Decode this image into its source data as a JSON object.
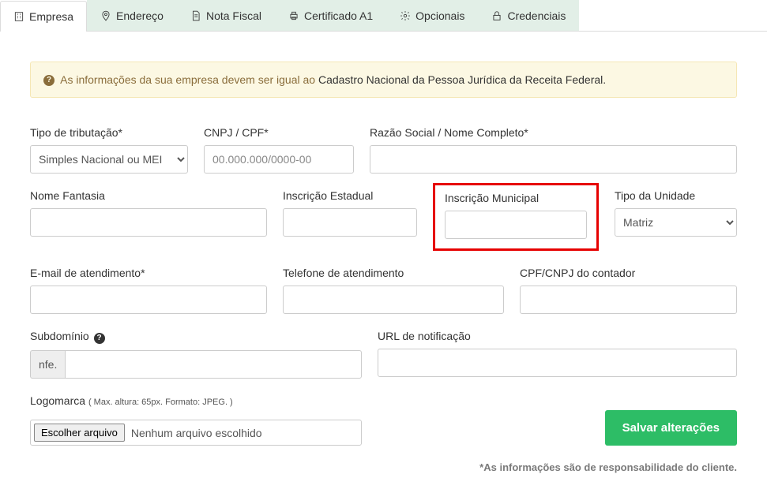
{
  "tabs": {
    "empresa": "Empresa",
    "endereco": "Endereço",
    "nota_fiscal": "Nota Fiscal",
    "certificado": "Certificado A1",
    "opcionais": "Opcionais",
    "credenciais": "Credenciais"
  },
  "alert": {
    "text_a": "As informações da sua empresa devem ser igual ao ",
    "text_b": "Cadastro Nacional da Pessoa Jurídica da Receita Federal."
  },
  "labels": {
    "tipo_tributacao": "Tipo de tributação*",
    "cnpj_cpf": "CNPJ / CPF*",
    "razao_social": "Razão Social / Nome Completo*",
    "nome_fantasia": "Nome Fantasia",
    "inscricao_estadual": "Inscrição Estadual",
    "inscricao_municipal": "Inscrição Municipal",
    "tipo_unidade": "Tipo da Unidade",
    "email_atendimento": "E-mail de atendimento*",
    "telefone_atendimento": "Telefone de atendimento",
    "cpf_cnpj_contador": "CPF/CNPJ do contador",
    "subdominio": "Subdomínio",
    "url_notificacao": "URL de notificação",
    "logomarca": "Logomarca",
    "logomarca_hint": "( Max. altura: 65px. Formato: JPEG. )"
  },
  "values": {
    "tipo_tributacao_selected": "Simples Nacional ou MEI",
    "cnpj_cpf_placeholder": "00.000.000/0000-00",
    "tipo_unidade_selected": "Matriz",
    "subdominio_prefix": "nfe.",
    "file_button": "Escolher arquivo",
    "file_none": "Nenhum arquivo escolhido"
  },
  "buttons": {
    "save": "Salvar alterações"
  },
  "footer_note": "*As informações são de responsabilidade do cliente."
}
